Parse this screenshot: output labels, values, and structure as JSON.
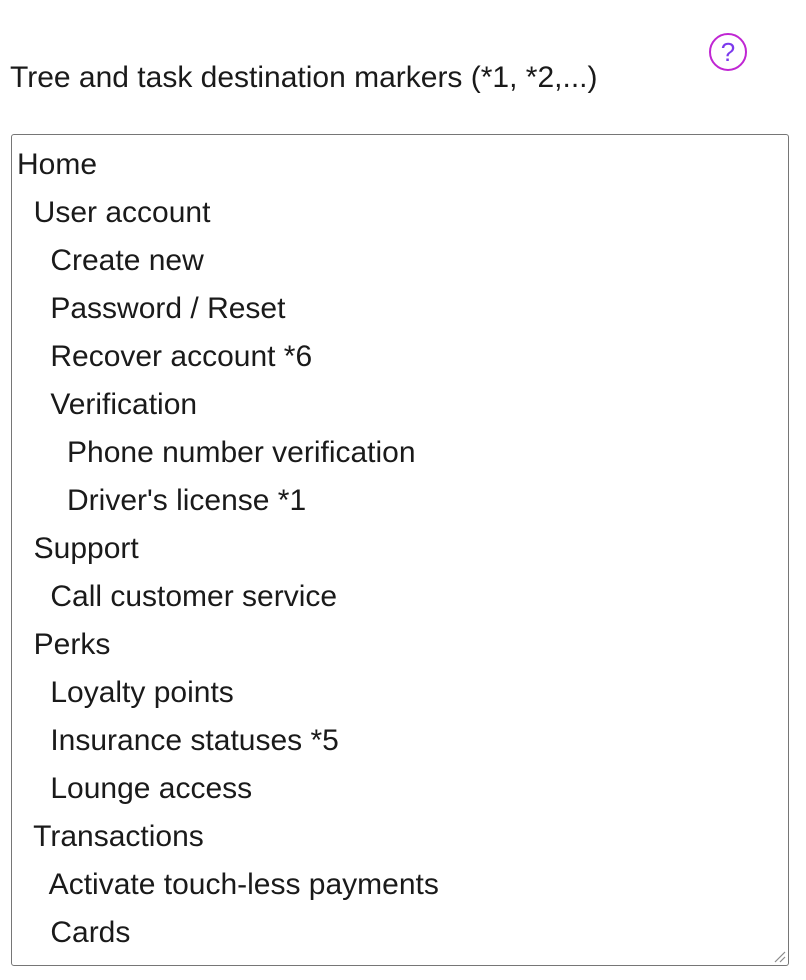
{
  "field": {
    "label": "Tree and task destination markers (*1, *2,...)",
    "help_glyph": "?"
  },
  "tree": {
    "lines": [
      "Home",
      "  User account",
      "    Create new",
      "    Password / Reset",
      "    Recover account *6",
      "    Verification",
      "      Phone number verification",
      "      Driver's license *1",
      "  Support",
      "    Call customer service",
      "  Perks",
      "    Loyalty points",
      "    Insurance statuses *5",
      "    Lounge access",
      "  Transactions",
      "    Activate touch-less payments",
      "    Cards"
    ]
  },
  "colors": {
    "help_ring": "#c026d3",
    "help_glyph": "#7c3aed",
    "border": "#767676",
    "text": "#1a1a1a"
  },
  "icons": {
    "help": "question-circle-icon",
    "resize": "resize-grip-icon"
  }
}
